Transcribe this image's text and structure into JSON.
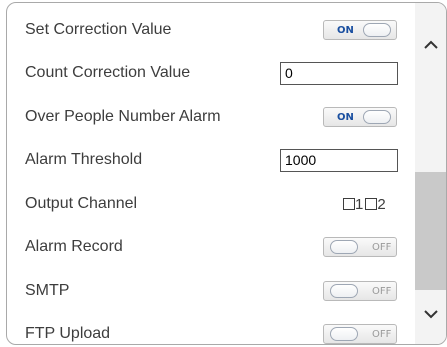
{
  "settings": {
    "set_correction": {
      "label": "Set Correction Value",
      "state": "ON"
    },
    "count_correction": {
      "label": "Count Correction Value",
      "value": "0"
    },
    "over_people_alarm": {
      "label": "Over People Number Alarm",
      "state": "ON"
    },
    "alarm_threshold": {
      "label": "Alarm Threshold",
      "value": "1000"
    },
    "output_channel": {
      "label": "Output Channel",
      "options": [
        "1",
        "2"
      ],
      "checked": [
        false,
        false
      ]
    },
    "alarm_record": {
      "label": "Alarm Record",
      "state": "OFF"
    },
    "smtp": {
      "label": "SMTP",
      "state": "OFF"
    },
    "ftp_upload": {
      "label": "FTP Upload",
      "state": "OFF"
    }
  },
  "scrollbar": {
    "up_icon": "chevron-up-icon",
    "down_icon": "chevron-down-icon"
  },
  "colors": {
    "toggle_on_text": "#1a4fa0",
    "toggle_off_text": "#9a9a9a",
    "label_text": "#3d3d3d",
    "scroll_thumb": "#c9c9c9"
  }
}
